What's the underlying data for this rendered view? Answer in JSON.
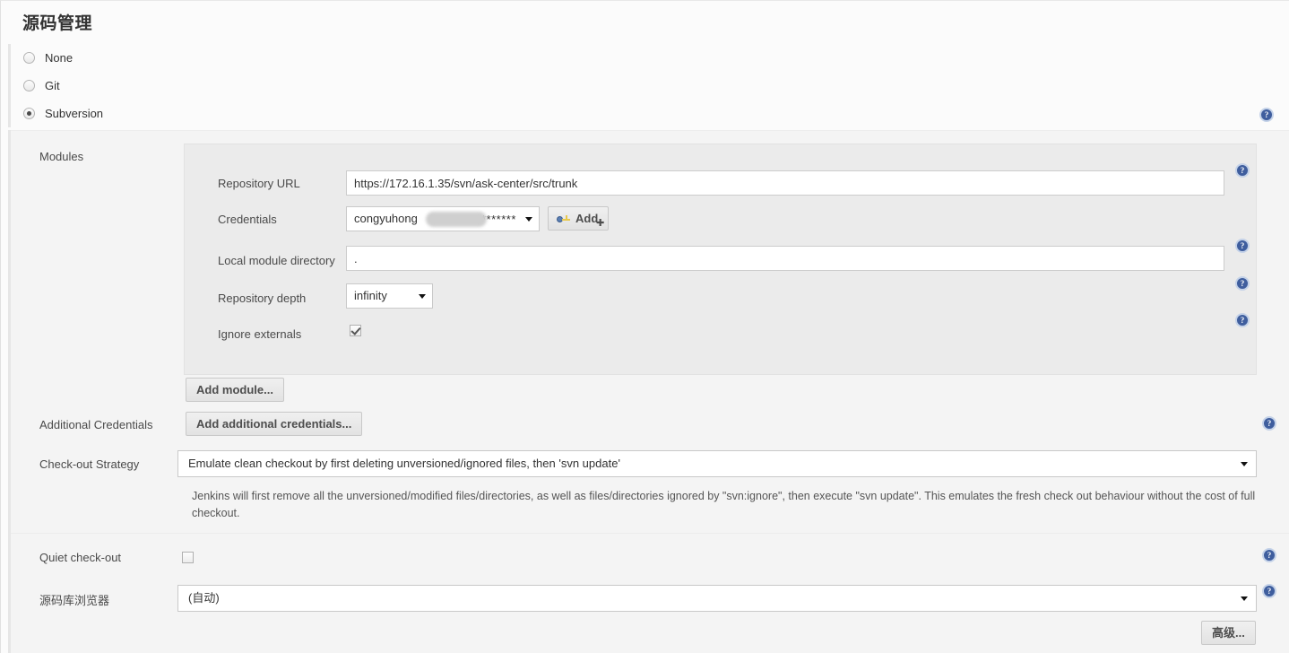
{
  "page": {
    "title": "源码管理"
  },
  "scm_options": [
    {
      "label": "None",
      "selected": false
    },
    {
      "label": "Git",
      "selected": false
    },
    {
      "label": "Subversion",
      "selected": true
    }
  ],
  "sections": {
    "modules_label": "Modules",
    "additional_credentials_label": "Additional Credentials",
    "checkout_strategy_label": "Check-out Strategy",
    "quiet_checkout_label": "Quiet check-out",
    "repository_browser_label": "源码库浏览器"
  },
  "module": {
    "repository_url": {
      "label": "Repository URL",
      "value": "https://172.16.1.35/svn/ask-center/src/trunk"
    },
    "credentials": {
      "label": "Credentials",
      "value": "congyuhong",
      "masked": "*******"
    },
    "add_credentials_button": "Add",
    "local_module_directory": {
      "label": "Local module directory",
      "value": "."
    },
    "repository_depth": {
      "label": "Repository depth",
      "value": "infinity"
    },
    "ignore_externals": {
      "label": "Ignore externals",
      "checked": true
    },
    "add_module_button": "Add module..."
  },
  "additional_credentials": {
    "button": "Add additional credentials..."
  },
  "checkout_strategy": {
    "value": "Emulate clean checkout by first deleting unversioned/ignored files, then 'svn update'",
    "description": "Jenkins will first remove all the unversioned/modified files/directories, as well as files/directories ignored by \"svn:ignore\", then execute \"svn update\". This emulates the fresh check out behaviour without the cost of full checkout."
  },
  "quiet_checkout": {
    "checked": false
  },
  "repository_browser": {
    "value": "(自动)"
  },
  "advanced_button": {
    "label": "高级..."
  },
  "icons": {
    "help": "help-icon",
    "key": "key-icon",
    "caret": "chevron-down-icon"
  },
  "colors": {
    "help_icon": "#3f5e9e",
    "panel_background": "#ebebeb",
    "body_background": "#f4f4f4"
  }
}
